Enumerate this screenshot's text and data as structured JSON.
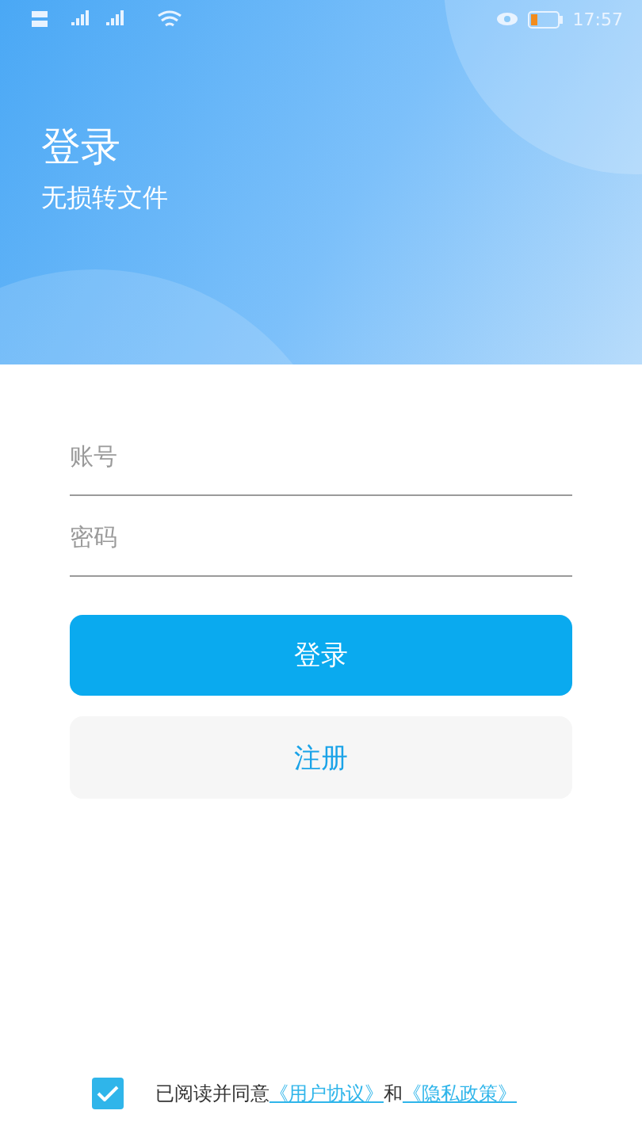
{
  "status_bar": {
    "time": "17:57"
  },
  "header": {
    "title": "登录",
    "subtitle": "无损转文件"
  },
  "fields": [
    {
      "placeholder": "账号"
    },
    {
      "placeholder": "密码"
    }
  ],
  "buttons": [
    {
      "label": "登录",
      "kind": "primary"
    },
    {
      "label": "注册",
      "kind": "secondary"
    }
  ],
  "agreement": {
    "checked": true,
    "text": "已阅读并同意",
    "links": [
      "《用户协议》",
      "《隐私政策》"
    ],
    "joiner": "和"
  }
}
